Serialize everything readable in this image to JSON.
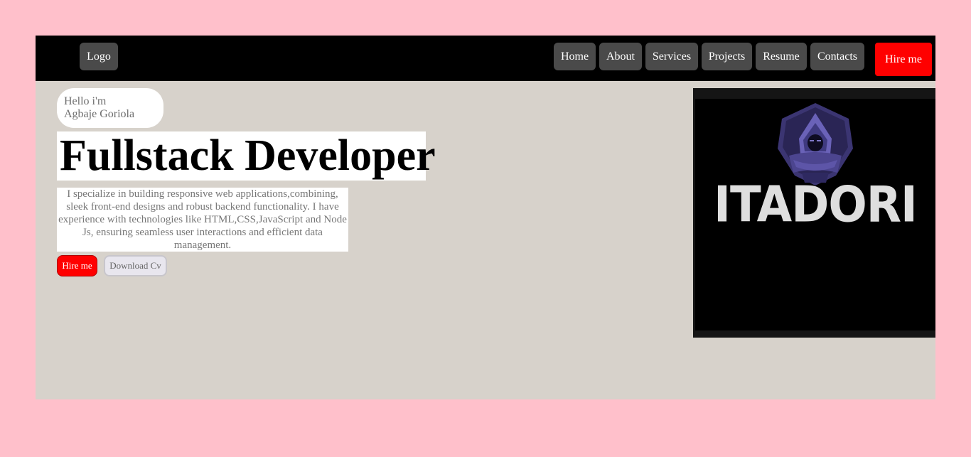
{
  "nav": {
    "logo": "Logo",
    "items": [
      "Home",
      "About",
      "Services",
      "Projects",
      "Resume",
      "Contacts"
    ],
    "hire_label": "Hire me"
  },
  "hero": {
    "greeting_line1": "Hello i'm",
    "greeting_line2": "Agbaje Goriola",
    "title": "Fullstack Developer",
    "description": "I specialize in building responsive web applications,combining, sleek front-end designs and robust backend functionality. I have experience with technologies like HTML,CSS,JavaScript and Node Js, ensuring seamless user interactions and efficient data management.",
    "hire_button": "Hire me",
    "cv_button": "Download Cv"
  },
  "image": {
    "brand_text": "ITADORI",
    "icon": "hooded-ninja-shield-icon"
  },
  "colors": {
    "page_bg": "#ffc0cb",
    "panel_bg": "#d7d2cb",
    "navbar_bg": "#000000",
    "nav_button_bg": "#4a4a4a",
    "accent_red": "#ff0000"
  }
}
